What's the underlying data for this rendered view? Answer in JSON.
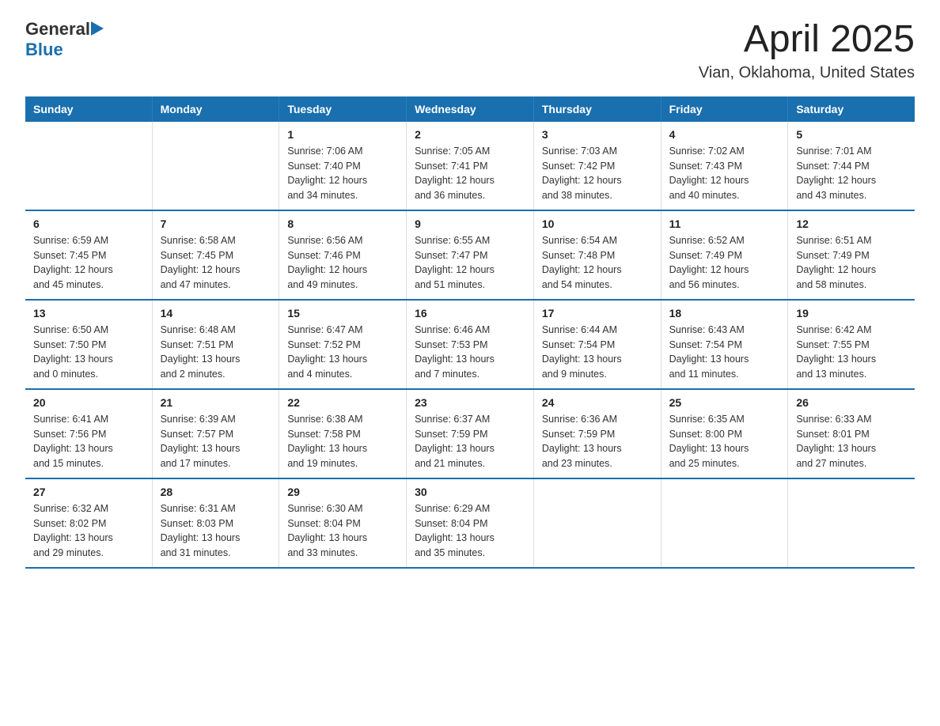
{
  "header": {
    "logo_general": "General",
    "logo_blue": "Blue",
    "title": "April 2025",
    "subtitle": "Vian, Oklahoma, United States"
  },
  "weekdays": [
    "Sunday",
    "Monday",
    "Tuesday",
    "Wednesday",
    "Thursday",
    "Friday",
    "Saturday"
  ],
  "weeks": [
    [
      {
        "day": "",
        "info": ""
      },
      {
        "day": "",
        "info": ""
      },
      {
        "day": "1",
        "info": "Sunrise: 7:06 AM\nSunset: 7:40 PM\nDaylight: 12 hours\nand 34 minutes."
      },
      {
        "day": "2",
        "info": "Sunrise: 7:05 AM\nSunset: 7:41 PM\nDaylight: 12 hours\nand 36 minutes."
      },
      {
        "day": "3",
        "info": "Sunrise: 7:03 AM\nSunset: 7:42 PM\nDaylight: 12 hours\nand 38 minutes."
      },
      {
        "day": "4",
        "info": "Sunrise: 7:02 AM\nSunset: 7:43 PM\nDaylight: 12 hours\nand 40 minutes."
      },
      {
        "day": "5",
        "info": "Sunrise: 7:01 AM\nSunset: 7:44 PM\nDaylight: 12 hours\nand 43 minutes."
      }
    ],
    [
      {
        "day": "6",
        "info": "Sunrise: 6:59 AM\nSunset: 7:45 PM\nDaylight: 12 hours\nand 45 minutes."
      },
      {
        "day": "7",
        "info": "Sunrise: 6:58 AM\nSunset: 7:45 PM\nDaylight: 12 hours\nand 47 minutes."
      },
      {
        "day": "8",
        "info": "Sunrise: 6:56 AM\nSunset: 7:46 PM\nDaylight: 12 hours\nand 49 minutes."
      },
      {
        "day": "9",
        "info": "Sunrise: 6:55 AM\nSunset: 7:47 PM\nDaylight: 12 hours\nand 51 minutes."
      },
      {
        "day": "10",
        "info": "Sunrise: 6:54 AM\nSunset: 7:48 PM\nDaylight: 12 hours\nand 54 minutes."
      },
      {
        "day": "11",
        "info": "Sunrise: 6:52 AM\nSunset: 7:49 PM\nDaylight: 12 hours\nand 56 minutes."
      },
      {
        "day": "12",
        "info": "Sunrise: 6:51 AM\nSunset: 7:49 PM\nDaylight: 12 hours\nand 58 minutes."
      }
    ],
    [
      {
        "day": "13",
        "info": "Sunrise: 6:50 AM\nSunset: 7:50 PM\nDaylight: 13 hours\nand 0 minutes."
      },
      {
        "day": "14",
        "info": "Sunrise: 6:48 AM\nSunset: 7:51 PM\nDaylight: 13 hours\nand 2 minutes."
      },
      {
        "day": "15",
        "info": "Sunrise: 6:47 AM\nSunset: 7:52 PM\nDaylight: 13 hours\nand 4 minutes."
      },
      {
        "day": "16",
        "info": "Sunrise: 6:46 AM\nSunset: 7:53 PM\nDaylight: 13 hours\nand 7 minutes."
      },
      {
        "day": "17",
        "info": "Sunrise: 6:44 AM\nSunset: 7:54 PM\nDaylight: 13 hours\nand 9 minutes."
      },
      {
        "day": "18",
        "info": "Sunrise: 6:43 AM\nSunset: 7:54 PM\nDaylight: 13 hours\nand 11 minutes."
      },
      {
        "day": "19",
        "info": "Sunrise: 6:42 AM\nSunset: 7:55 PM\nDaylight: 13 hours\nand 13 minutes."
      }
    ],
    [
      {
        "day": "20",
        "info": "Sunrise: 6:41 AM\nSunset: 7:56 PM\nDaylight: 13 hours\nand 15 minutes."
      },
      {
        "day": "21",
        "info": "Sunrise: 6:39 AM\nSunset: 7:57 PM\nDaylight: 13 hours\nand 17 minutes."
      },
      {
        "day": "22",
        "info": "Sunrise: 6:38 AM\nSunset: 7:58 PM\nDaylight: 13 hours\nand 19 minutes."
      },
      {
        "day": "23",
        "info": "Sunrise: 6:37 AM\nSunset: 7:59 PM\nDaylight: 13 hours\nand 21 minutes."
      },
      {
        "day": "24",
        "info": "Sunrise: 6:36 AM\nSunset: 7:59 PM\nDaylight: 13 hours\nand 23 minutes."
      },
      {
        "day": "25",
        "info": "Sunrise: 6:35 AM\nSunset: 8:00 PM\nDaylight: 13 hours\nand 25 minutes."
      },
      {
        "day": "26",
        "info": "Sunrise: 6:33 AM\nSunset: 8:01 PM\nDaylight: 13 hours\nand 27 minutes."
      }
    ],
    [
      {
        "day": "27",
        "info": "Sunrise: 6:32 AM\nSunset: 8:02 PM\nDaylight: 13 hours\nand 29 minutes."
      },
      {
        "day": "28",
        "info": "Sunrise: 6:31 AM\nSunset: 8:03 PM\nDaylight: 13 hours\nand 31 minutes."
      },
      {
        "day": "29",
        "info": "Sunrise: 6:30 AM\nSunset: 8:04 PM\nDaylight: 13 hours\nand 33 minutes."
      },
      {
        "day": "30",
        "info": "Sunrise: 6:29 AM\nSunset: 8:04 PM\nDaylight: 13 hours\nand 35 minutes."
      },
      {
        "day": "",
        "info": ""
      },
      {
        "day": "",
        "info": ""
      },
      {
        "day": "",
        "info": ""
      }
    ]
  ]
}
